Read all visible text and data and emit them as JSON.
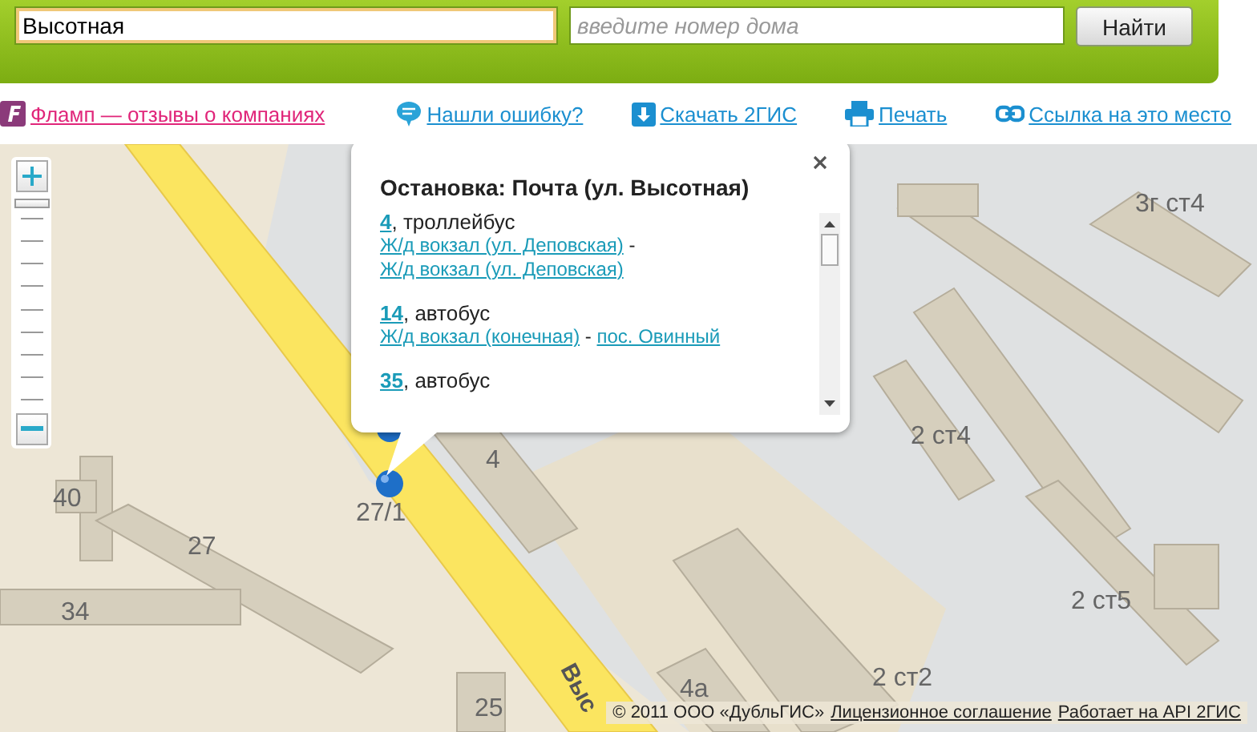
{
  "search": {
    "street_value": "Высотная",
    "house_placeholder": "введите номер дома",
    "button": "Найти"
  },
  "links": [
    {
      "kind": "flamp",
      "label": "Фламп — отзывы о компаниях"
    },
    {
      "kind": "error",
      "label": "Нашли ошибку?"
    },
    {
      "kind": "download",
      "label": "Скачать 2ГИС"
    },
    {
      "kind": "print",
      "label": "Печать"
    },
    {
      "kind": "link",
      "label": "Ссылка на это место"
    }
  ],
  "map": {
    "zoom": {
      "level": 1
    },
    "house_labels": [
      "3г ст4",
      "2 ст4",
      "4",
      "40",
      "27",
      "34",
      "2 ст5",
      "4а",
      "2 ст2",
      "25",
      "27/1"
    ],
    "street_label": "Выс",
    "popup": {
      "title": "Остановка: Почта (ул. Высотная)",
      "routes": [
        {
          "number": "4",
          "type": ", троллейбус",
          "stops": [
            "Ж/д вокзал (ул. Деповская)",
            "Ж/д вокзал (ул. Деповская)"
          ]
        },
        {
          "number": "14",
          "type": ", автобус",
          "stops": [
            "Ж/д вокзал (конечная)",
            "пос. Овинный"
          ]
        },
        {
          "number": "35",
          "type": ", автобус"
        }
      ],
      "separator": "-"
    },
    "footer": {
      "copyright": "© 2011 ООО «ДубльГИС»",
      "links": [
        "Лицензионное соглашение",
        "Работает на API 2ГИС"
      ]
    }
  }
}
